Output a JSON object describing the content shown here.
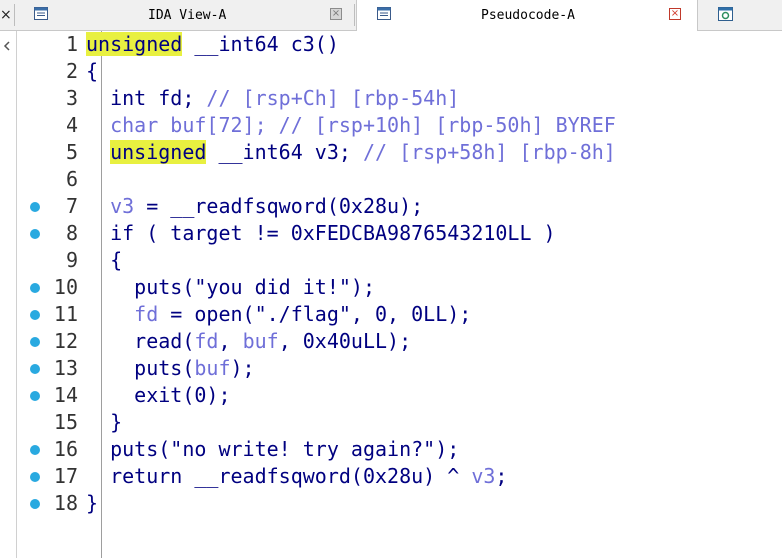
{
  "tabs": [
    {
      "title": "IDA View-A",
      "close": "×"
    },
    {
      "title": "Pseudocode-A",
      "close": "×"
    }
  ],
  "left_edge_glyph": "×",
  "colors": {
    "highlight": "#e8f040",
    "comment": "#6f6fd8",
    "code": "#000080",
    "breakpoint_dot": "#29a9e0"
  },
  "code": {
    "lines": [
      {
        "n": "1",
        "dot": false,
        "segments": [
          {
            "t": "unsigned",
            "c": "kw hl"
          },
          {
            "t": " __int64 c3()",
            "c": ""
          }
        ]
      },
      {
        "n": "2",
        "dot": false,
        "segments": [
          {
            "t": "{",
            "c": ""
          }
        ]
      },
      {
        "n": "3",
        "dot": false,
        "segments": [
          {
            "t": "  int fd; ",
            "c": ""
          },
          {
            "t": "// [rsp+Ch] [rbp-54h]",
            "c": "cm"
          }
        ]
      },
      {
        "n": "4",
        "dot": false,
        "segments": [
          {
            "t": "  char buf[72]; ",
            "c": "vr"
          },
          {
            "t": "// [rsp+10h] [rbp-50h] BYREF",
            "c": "cm"
          }
        ]
      },
      {
        "n": "5",
        "dot": false,
        "segments": [
          {
            "t": "  ",
            "c": ""
          },
          {
            "t": "unsigned",
            "c": "hl"
          },
          {
            "t": " __int64 v3; ",
            "c": ""
          },
          {
            "t": "// [rsp+58h] [rbp-8h]",
            "c": "cm"
          }
        ]
      },
      {
        "n": "6",
        "dot": false,
        "segments": [
          {
            "t": "",
            "c": ""
          }
        ]
      },
      {
        "n": "7",
        "dot": true,
        "segments": [
          {
            "t": "  ",
            "c": ""
          },
          {
            "t": "v3",
            "c": "vr"
          },
          {
            "t": " = __readfsqword(0x28u);",
            "c": ""
          }
        ]
      },
      {
        "n": "8",
        "dot": true,
        "segments": [
          {
            "t": "  if ( target != 0xFEDCBA9876543210LL )",
            "c": ""
          }
        ]
      },
      {
        "n": "9",
        "dot": false,
        "segments": [
          {
            "t": "  {",
            "c": ""
          }
        ]
      },
      {
        "n": "10",
        "dot": true,
        "segments": [
          {
            "t": "    puts(\"you did it!\");",
            "c": ""
          }
        ]
      },
      {
        "n": "11",
        "dot": true,
        "segments": [
          {
            "t": "    ",
            "c": ""
          },
          {
            "t": "fd",
            "c": "vr"
          },
          {
            "t": " = open(\"./flag\", 0, 0LL);",
            "c": ""
          }
        ]
      },
      {
        "n": "12",
        "dot": true,
        "segments": [
          {
            "t": "    read(",
            "c": ""
          },
          {
            "t": "fd",
            "c": "vr"
          },
          {
            "t": ", ",
            "c": ""
          },
          {
            "t": "buf",
            "c": "vr"
          },
          {
            "t": ", 0x40uLL);",
            "c": ""
          }
        ]
      },
      {
        "n": "13",
        "dot": true,
        "segments": [
          {
            "t": "    puts(",
            "c": ""
          },
          {
            "t": "buf",
            "c": "vr"
          },
          {
            "t": ");",
            "c": ""
          }
        ]
      },
      {
        "n": "14",
        "dot": true,
        "segments": [
          {
            "t": "    exit(0);",
            "c": ""
          }
        ]
      },
      {
        "n": "15",
        "dot": false,
        "segments": [
          {
            "t": "  }",
            "c": ""
          }
        ]
      },
      {
        "n": "16",
        "dot": true,
        "segments": [
          {
            "t": "  puts(\"no write! try again?\");",
            "c": ""
          }
        ]
      },
      {
        "n": "17",
        "dot": true,
        "segments": [
          {
            "t": "  return __readfsqword(0x28u) ^ ",
            "c": ""
          },
          {
            "t": "v3",
            "c": "vr"
          },
          {
            "t": ";",
            "c": ""
          }
        ]
      },
      {
        "n": "18",
        "dot": true,
        "segments": [
          {
            "t": "}",
            "c": ""
          }
        ]
      }
    ]
  }
}
